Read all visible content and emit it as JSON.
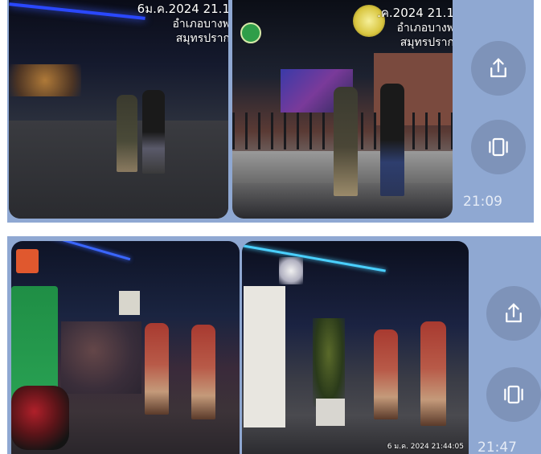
{
  "messages": [
    {
      "time": "21:09",
      "photos": [
        {
          "overlay_lines": [
            "6ม.ค.2024 21.1",
            "อำเภอบางพ",
            "สมุทรปราก"
          ]
        },
        {
          "overlay_lines": [
            ".ค.2024 21.1",
            "อำเภอบางพ",
            "สมุทรปราก"
          ]
        }
      ],
      "actions": [
        {
          "name": "share",
          "icon": "share-icon"
        },
        {
          "name": "view",
          "icon": "carousel-icon"
        }
      ]
    },
    {
      "time": "21:47",
      "photos": [
        {
          "overlay_lines": []
        },
        {
          "overlay_lines": [
            "6 ม.ค. 2024 21:44:05"
          ]
        }
      ],
      "actions": [
        {
          "name": "share",
          "icon": "share-icon"
        },
        {
          "name": "view",
          "icon": "carousel-icon"
        }
      ]
    }
  ],
  "colors": {
    "chat_background": "#8fa8d2",
    "action_button": "#7e93b9",
    "timestamp": "#e6ecf6"
  }
}
